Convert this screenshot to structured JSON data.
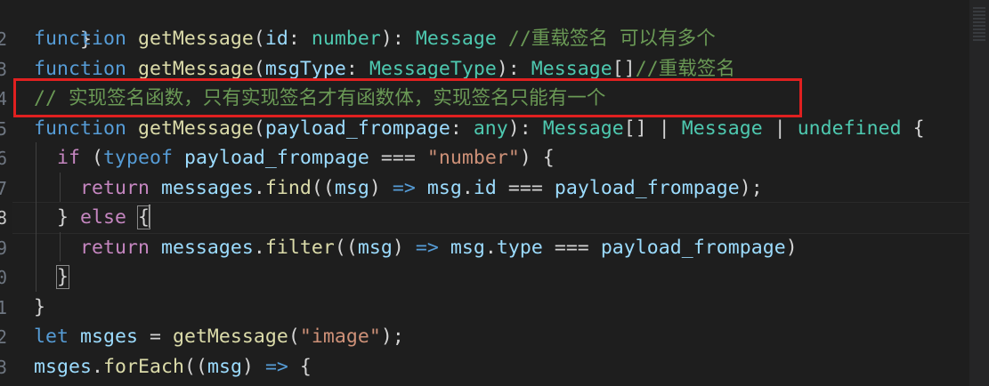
{
  "gutter": {
    "line_numbers": [
      "",
      "2",
      "3",
      "4",
      "5",
      "6",
      "7",
      "8",
      "9",
      "0",
      "1",
      "2",
      "3"
    ]
  },
  "code": {
    "l1": {
      "close": "}"
    },
    "l2": {
      "kw": "function",
      "fn": "getMessage",
      "p1": "(",
      "param": "id",
      "c1": ": ",
      "ptype": "number",
      "p2": "): ",
      "rtype": "Message",
      "comment": " //重载签名 可以有多个"
    },
    "l3": {
      "kw": "function",
      "fn": "getMessage",
      "p1": "(",
      "param": "msgType",
      "c1": ": ",
      "ptype": "MessageType",
      "p2": "): ",
      "rtype": "Message",
      "arr": "[]",
      "comment": "//重载签名"
    },
    "l4": {
      "comment": "// 实现签名函数，只有实现签名才有函数体，实现签名只能有一个"
    },
    "l5": {
      "kw": "function",
      "fn": "getMessage",
      "p1": "(",
      "param": "payload_frompage",
      "c1": ": ",
      "ptype": "any",
      "p2": "): ",
      "rtype": "Message",
      "arr": "[]",
      "bar1": " | ",
      "rtype2": "Message",
      "bar2": " | ",
      "rtype3": "undefined",
      "brace": " {"
    },
    "l6": {
      "ind": "  ",
      "kw": "if",
      "p1": " (",
      "op": "typeof",
      "sp": " ",
      "var": "payload_frompage",
      "eq": " === ",
      "str": "\"number\"",
      "p2": ") {"
    },
    "l7": {
      "ind": "    ",
      "kw": "return",
      "sp": " ",
      "var": "messages",
      "dot": ".",
      "fn": "find",
      "p1": "((",
      "arg": "msg",
      "p2": ") ",
      "arrow": "=>",
      "sp2": " ",
      "var2": "msg",
      "dot2": ".",
      "prop": "id",
      "eq": " === ",
      "var3": "payload_frompage",
      "end": ");"
    },
    "l8": {
      "ind": "  ",
      "close": "} ",
      "kw": "else",
      "sp": " ",
      "brace": "{"
    },
    "l9": {
      "ind": "    ",
      "kw": "return",
      "sp": " ",
      "var": "messages",
      "dot": ".",
      "fn": "filter",
      "p1": "((",
      "arg": "msg",
      "p2": ") ",
      "arrow": "=>",
      "sp2": " ",
      "var2": "msg",
      "dot2": ".",
      "prop": "type",
      "eq": " === ",
      "var3": "payload_frompage",
      "end": ")"
    },
    "l10": {
      "ind": "  ",
      "close": "}"
    },
    "l11": {
      "close": "}"
    },
    "l12": {
      "kw": "let",
      "sp": " ",
      "var": "msges",
      "eq": " = ",
      "fn": "getMessage",
      "p1": "(",
      "str": "\"image\"",
      "end": ");"
    },
    "l13": {
      "var": "msges",
      "dot": ".",
      "fn": "forEach",
      "p1": "((",
      "arg": "msg",
      "p2": ") ",
      "arrow": "=>",
      "brace": " {"
    }
  },
  "colors": {
    "background": "#1e1e1e",
    "keyword": "#569cd6",
    "control": "#c586c0",
    "function": "#dcdcaa",
    "variable": "#9cdcfe",
    "type": "#4ec9b0",
    "string": "#ce9178",
    "comment": "#6a9955",
    "highlight_box": "#e02020"
  }
}
